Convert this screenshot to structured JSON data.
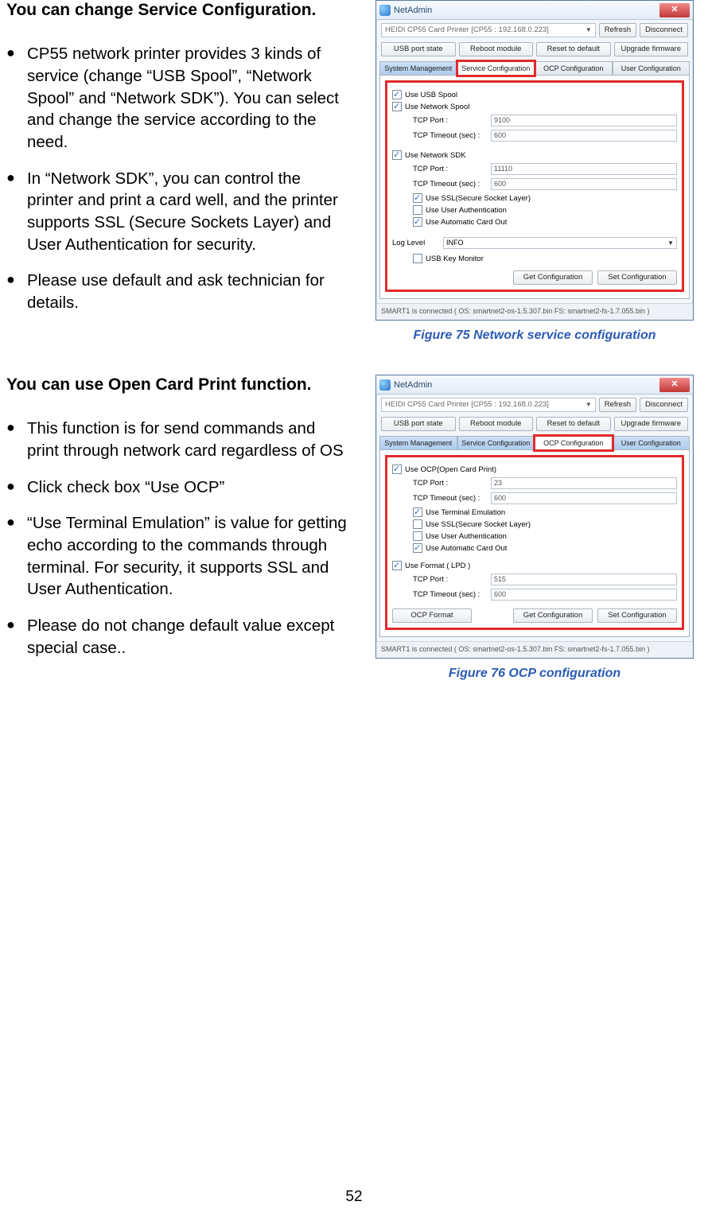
{
  "page_number": "52",
  "section1": {
    "heading": "You can change Service Configuration.",
    "bullets": [
      "CP55 network printer provides 3 kinds of service (change “USB Spool”, “Network Spool” and “Network SDK”). You can select and change the service according to the need.",
      "In “Network SDK”, you can control the printer and print a card well, and the printer supports SSL (Secure Sockets Layer) and User Authentication for security.",
      "Please use default and ask technician for details."
    ],
    "caption": "Figure 75 Network service configuration"
  },
  "section2": {
    "heading": "You can use Open Card Print function.",
    "bullets": [
      "This function is for send commands and print through network card regardless of OS",
      "Click check box “Use OCP”",
      "“Use Terminal Emulation” is value for getting echo according to the commands through terminal. For security, it supports SSL and User Authentication.",
      "Please do not change default value except special case.."
    ],
    "caption": "Figure 76 OCP configuration"
  },
  "win_common": {
    "app_title": "NetAdmin",
    "close_glyph": "✕",
    "address": "HEIDI CP55 Card Printer [CP55 : 192.168.0.223]",
    "refresh": "Refresh",
    "disconnect": "Disconnect",
    "btn_usb": "USB port state",
    "btn_reboot": "Reboot module",
    "btn_reset": "Reset to default",
    "btn_upgrade": "Upgrade firmware",
    "tab_sys": "System Management",
    "tab_svc": "Service Configuration",
    "tab_ocp": "OCP Configuration",
    "tab_user": "User Configuration",
    "get_conf": "Get Configuration",
    "set_conf": "Set Configuration"
  },
  "win1": {
    "use_usb_spool": "Use USB Spool",
    "use_net_spool": "Use Network Spool",
    "tcp_port_l": "TCP Port :",
    "tcp_port_v1": "9100",
    "tcp_timeout_l": "TCP Timeout (sec) :",
    "tcp_timeout_v1": "600",
    "use_net_sdk": "Use Network SDK",
    "tcp_port_v2": "11110",
    "tcp_timeout_v2": "600",
    "use_ssl": "Use SSL(Secure Socket Layer)",
    "use_auth": "Use User Authentication",
    "use_auto_card": "Use Automatic Card Out",
    "log_level_l": "Log Level",
    "log_level_v": "INFO",
    "usb_key_mon": "USB Key Monitor",
    "status": "SMART1 is connected ( OS: smartnet2-os-1.5.307.bin  FS: smartnet2-fs-1.7.055.bin )"
  },
  "win2": {
    "use_ocp": "Use OCP(Open Card Print)",
    "tcp_port_l": "TCP Port :",
    "tcp_port_v": "23",
    "tcp_timeout_l": "TCP Timeout (sec) :",
    "tcp_timeout_v": "600",
    "use_term": "Use Terminal Emulation",
    "use_ssl": "Use SSL(Secure Socket Layer)",
    "use_auth": "Use User Authentication",
    "use_auto_card": "Use Automatic Card Out",
    "use_format": "Use Format ( LPD )",
    "tcp_port_v2": "515",
    "tcp_timeout_v2": "600",
    "ocp_format": "OCP Format",
    "status": "SMART1 is connected ( OS: smartnet2-os-1.5.307.bin  FS: smartnet2-fs-1.7.055.bin )"
  }
}
